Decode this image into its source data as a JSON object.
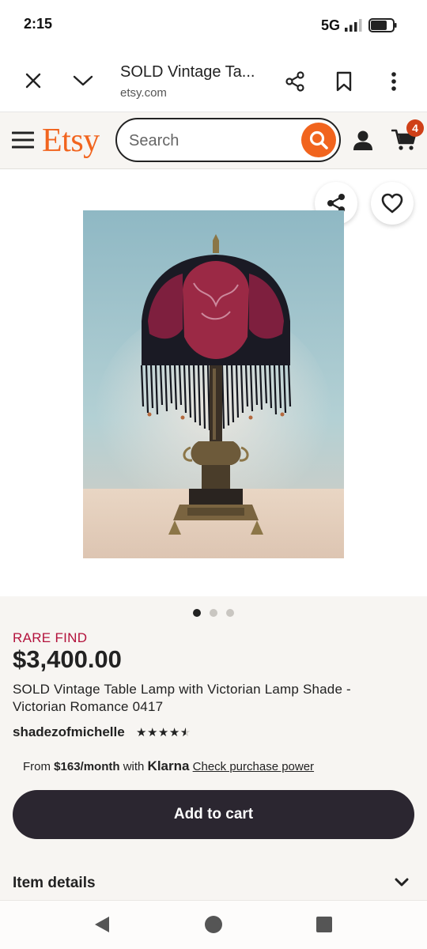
{
  "status_bar": {
    "time": "2:15",
    "network": "5G"
  },
  "browser": {
    "tab_title": "SOLD Vintage Ta...",
    "url": "etsy.com"
  },
  "header": {
    "logo": "Etsy",
    "search_placeholder": "Search",
    "cart_count": "4",
    "brand_color": "#f1641e"
  },
  "gallery": {
    "image_description": "Vintage table lamp with fringed Victorian shade",
    "dots_total": 3,
    "dot_active": 1
  },
  "product": {
    "badge": "RARE FIND",
    "price": "$3,400.00",
    "title": "SOLD Vintage Table Lamp with Victorian Lamp Shade - Victorian Romance 0417",
    "shop_name": "shadezofmichelle",
    "rating": 4.5,
    "klarna_prefix": "From ",
    "klarna_amount": "$163/month",
    "klarna_with": " with ",
    "klarna_brand": "Klarna",
    "klarna_link": "Check purchase power"
  },
  "actions": {
    "add_to_cart": "Add to cart",
    "item_details": "Item details"
  }
}
